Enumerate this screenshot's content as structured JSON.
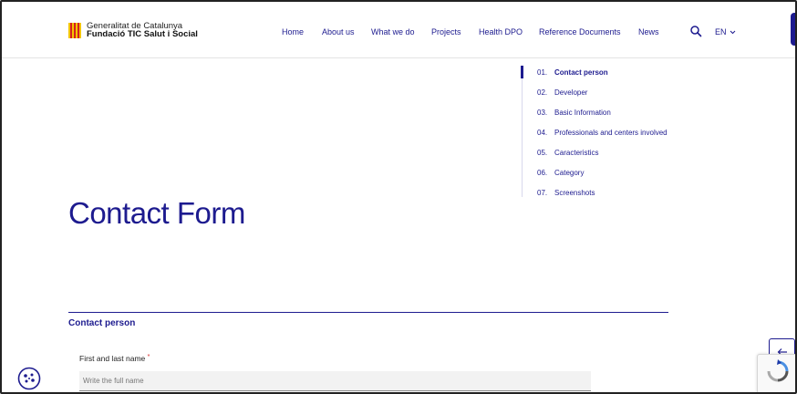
{
  "brand": {
    "line1": "Generalitat de Catalunya",
    "line2": "Fundació TIC Salut i Social"
  },
  "nav": {
    "items": [
      {
        "label": "Home"
      },
      {
        "label": "About us"
      },
      {
        "label": "What we do"
      },
      {
        "label": "Projects"
      },
      {
        "label": "Health DPO"
      },
      {
        "label": "Reference Documents"
      },
      {
        "label": "News"
      }
    ],
    "language": "EN"
  },
  "steps": [
    {
      "num": "01.",
      "label": "Contact person",
      "active": true
    },
    {
      "num": "02.",
      "label": "Developer"
    },
    {
      "num": "03.",
      "label": "Basic Information"
    },
    {
      "num": "04.",
      "label": "Professionals and centers involved"
    },
    {
      "num": "05.",
      "label": "Caracteristics"
    },
    {
      "num": "06.",
      "label": "Category"
    },
    {
      "num": "07.",
      "label": "Screenshots"
    }
  ],
  "page": {
    "title": "Contact Form"
  },
  "form": {
    "section_title": "Contact person",
    "name_label": "First and last name",
    "required_mark": "*",
    "name_placeholder": "Write the full name",
    "name_value": ""
  },
  "icons": {
    "search": "search-icon",
    "chevron": "chevron-down-icon",
    "back": "arrow-left-icon",
    "recaptcha": "recaptcha-icon",
    "cookie": "cookie-icon"
  },
  "colors": {
    "accent": "#1d1b8f",
    "required": "#d42020",
    "logo_yellow": "#f4c400",
    "logo_red": "#d42020"
  }
}
